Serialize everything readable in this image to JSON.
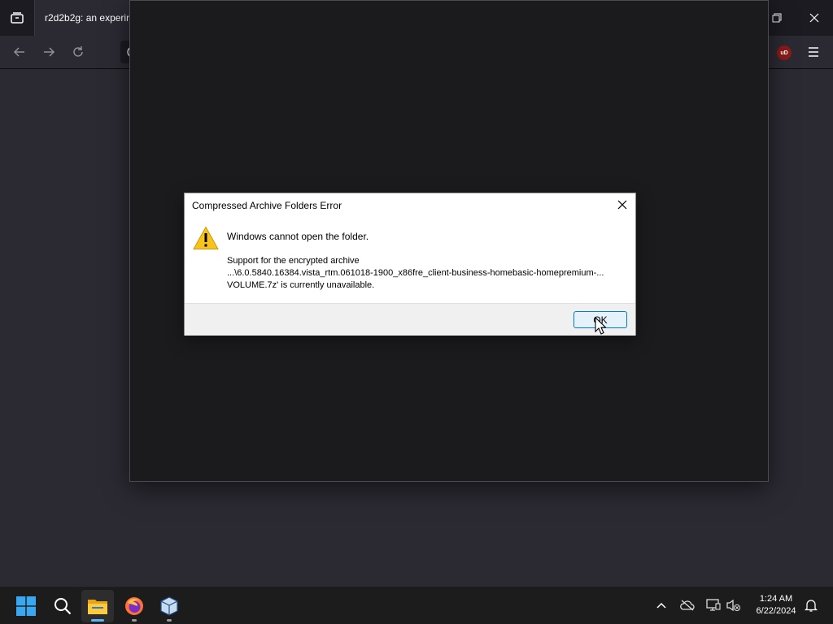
{
  "browser": {
    "tab_title": "r2d2b2g: an experim",
    "colors": {
      "tabbar": "#1c1b22",
      "toolbar": "#2b2a33",
      "ublock": "#8c1a1a"
    },
    "extension_label": "uD"
  },
  "dialog": {
    "title": "Compressed Archive Folders Error",
    "heading": "Windows cannot open the folder.",
    "body_line1": "Support for the encrypted archive",
    "body_line2": "...\\6.0.5840.16384.vista_rtm.061018-1900_x86fre_client-business-homebasic-homepremium-...",
    "body_line3": "VOLUME.7z' is currently unavailable.",
    "ok_label": "OK",
    "icon": "warning-icon"
  },
  "taskbar": {
    "apps": [
      "start",
      "search",
      "file-explorer",
      "firefox",
      "virtualbox"
    ],
    "time": "1:24 AM",
    "date": "6/22/2024"
  }
}
